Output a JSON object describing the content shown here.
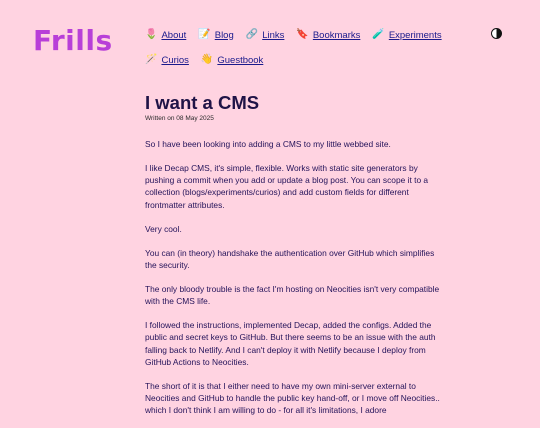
{
  "site": {
    "logo": "Frills"
  },
  "nav": {
    "row1": [
      {
        "icon": "🌷",
        "label": "About",
        "name": "about"
      },
      {
        "icon": "📝",
        "label": "Blog",
        "name": "blog"
      },
      {
        "icon": "🔗",
        "label": "Links",
        "name": "links"
      },
      {
        "icon": "🔖",
        "label": "Bookmarks",
        "name": "bookmarks"
      },
      {
        "icon": "🧪",
        "label": "Experiments",
        "name": "experiments"
      }
    ],
    "row2": [
      {
        "icon": "🪄",
        "label": "Curios",
        "name": "curios"
      },
      {
        "icon": "👋",
        "label": "Guestbook",
        "name": "guestbook"
      }
    ]
  },
  "post": {
    "title": "I want a CMS",
    "meta": "Written on 08 May 2025",
    "paragraphs": [
      "So I have been looking into adding a CMS to my little webbed site.",
      "I like Decap CMS, it's simple, flexible. Works with static site generators by pushing a commit when you add or update a blog post. You can scope it to a collection (blogs/experiments/curios) and add custom fields for different frontmatter attributes.",
      "Very cool.",
      "You can (in theory) handshake the authentication over GitHub which simplifies the security.",
      "The only bloody trouble is the fact I'm hosting on Neocities isn't very compatible with the CMS life.",
      "I followed the instructions, implemented Decap, added the configs. Added the public and secret keys to GitHub. But there seems to be an issue with the auth falling back to Netlify. And I can't deploy it with Netlify because I deploy from GitHub Actions to Neocities.",
      "The short of it is that I either need to have my own mini-server external to Neocities and GitHub to handle the public key hand-off, or I move off Neocities.. which I don't think I am willing to do - for all it's limitations, I adore"
    ]
  }
}
